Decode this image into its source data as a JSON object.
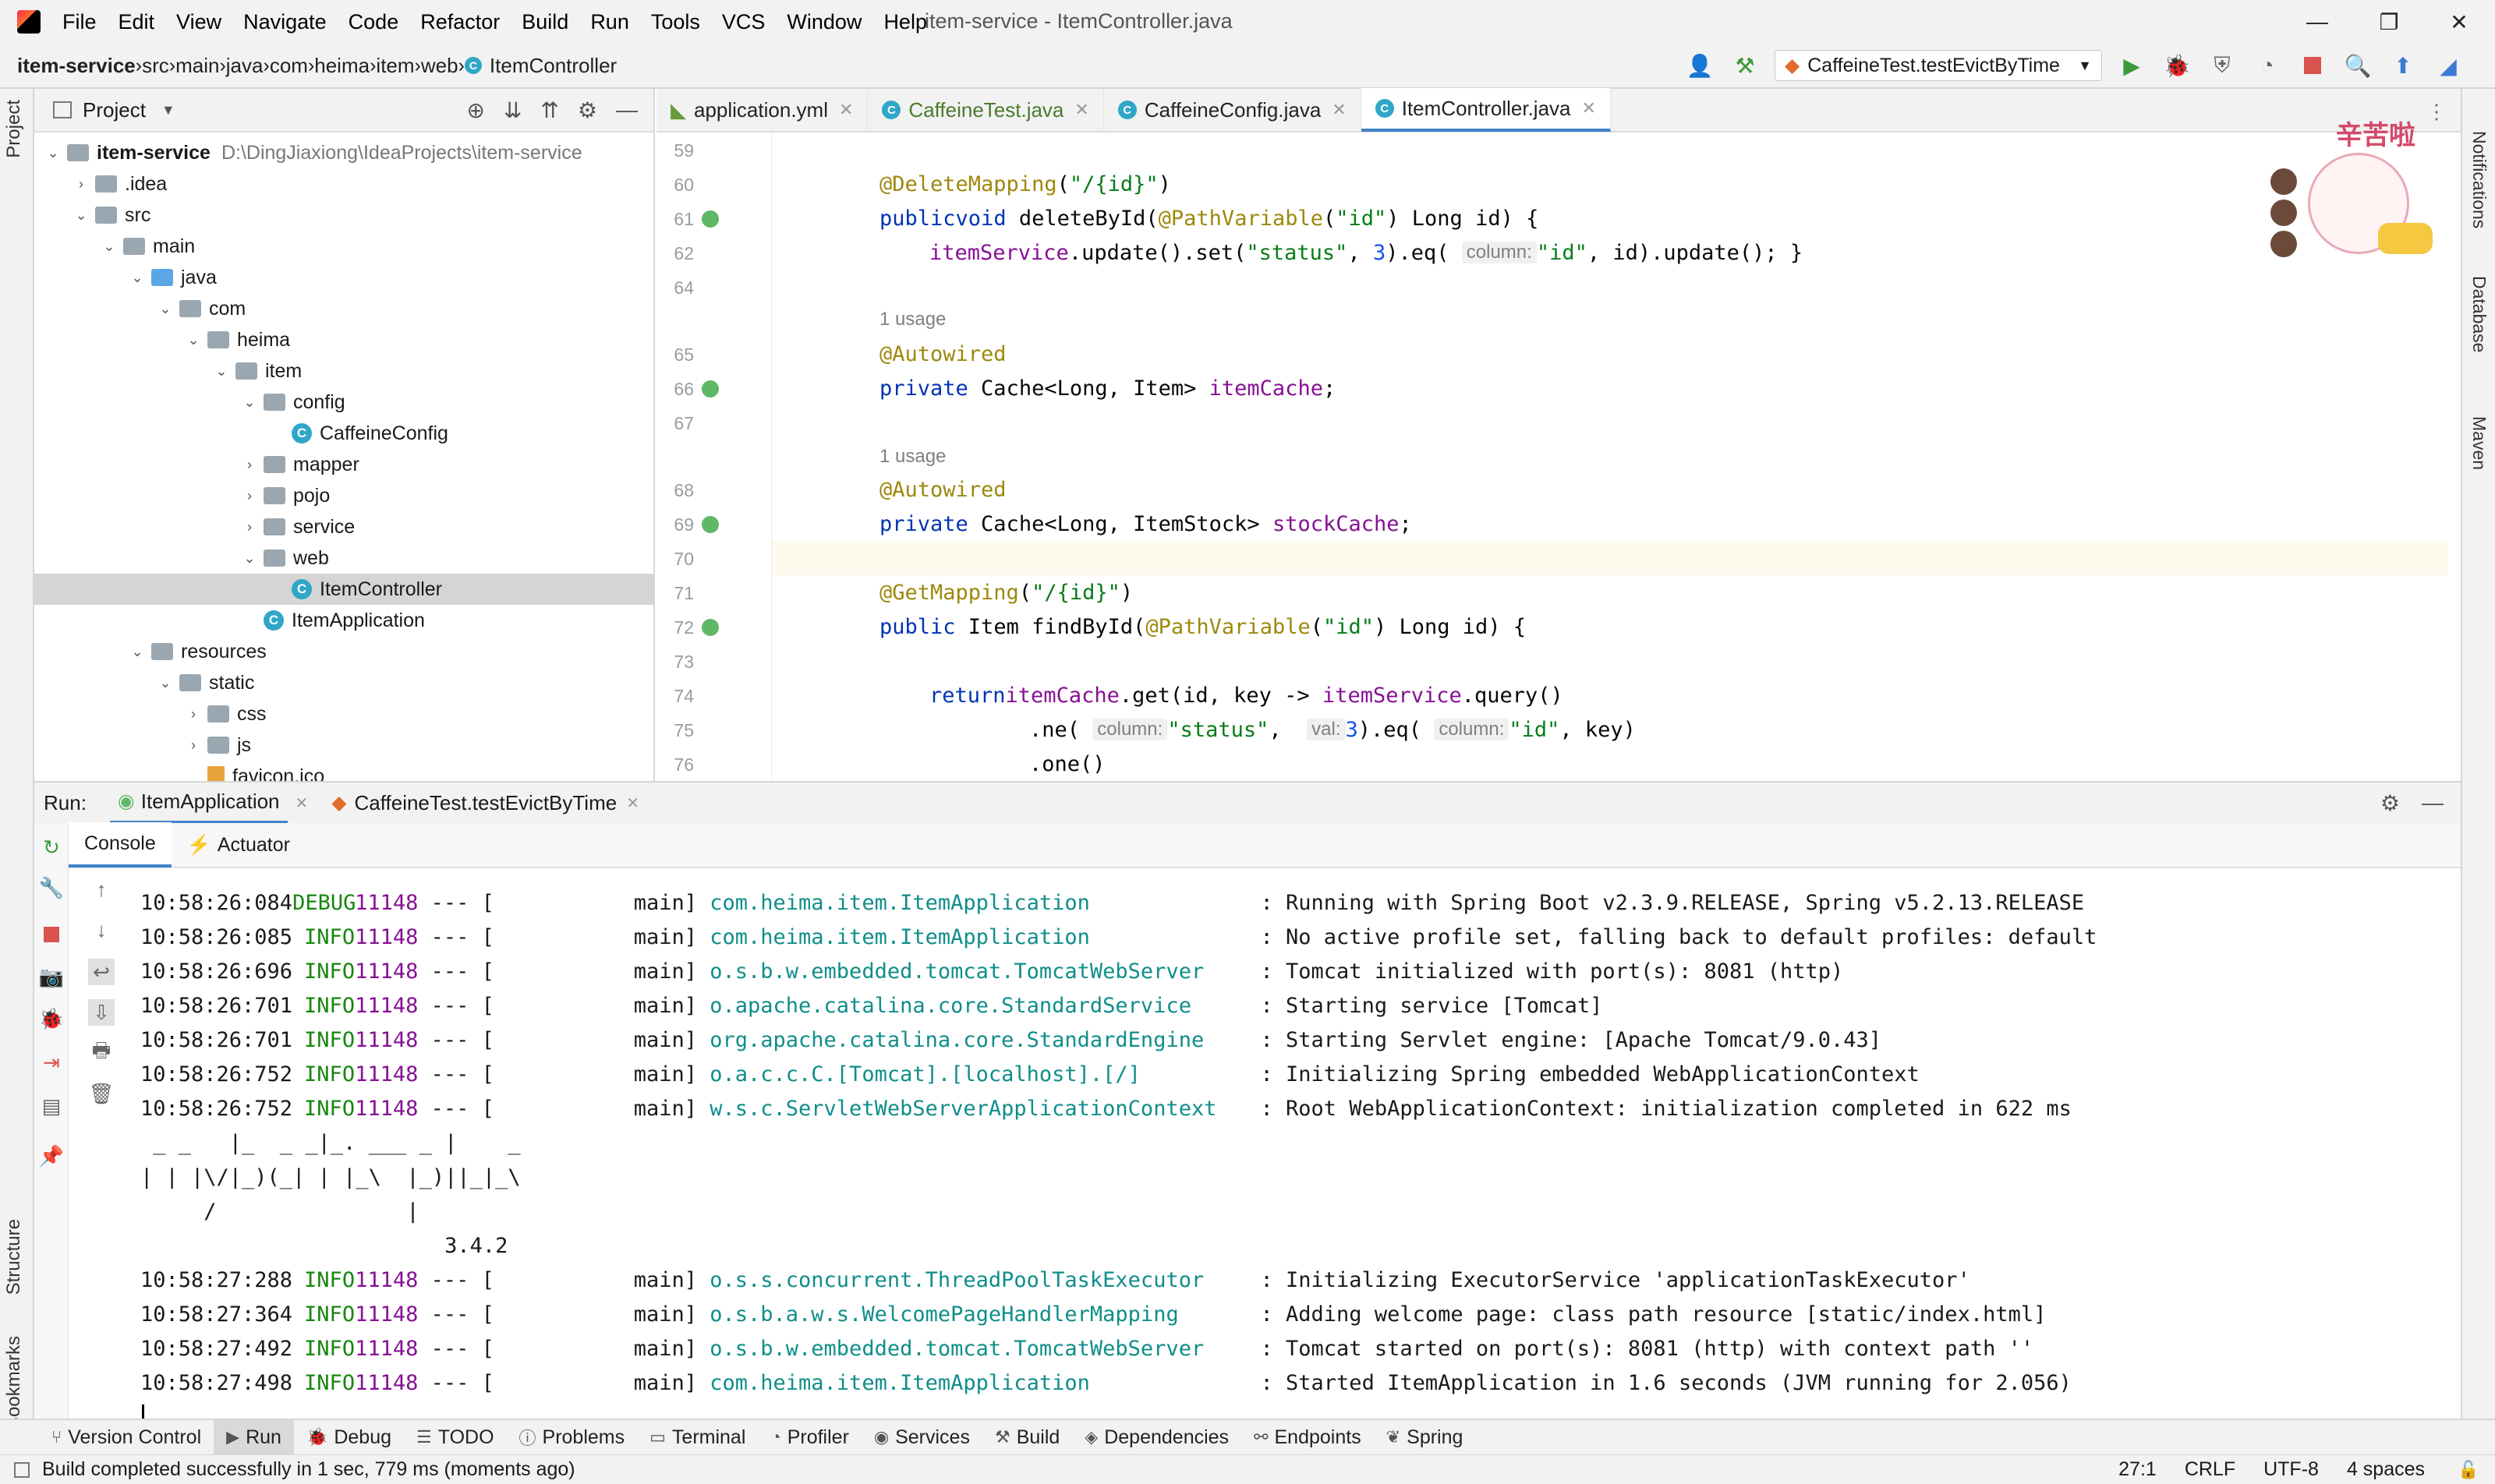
{
  "window": {
    "title": "item-service - ItemController.java",
    "menu": [
      "File",
      "Edit",
      "View",
      "Navigate",
      "Code",
      "Refactor",
      "Build",
      "Run",
      "Tools",
      "VCS",
      "Window",
      "Help"
    ]
  },
  "navbar": {
    "breadcrumbs": [
      "item-service",
      "src",
      "main",
      "java",
      "com",
      "heima",
      "item",
      "web",
      "ItemController"
    ],
    "run_config": "CaffeineTest.testEvictByTime"
  },
  "project": {
    "title": "Project",
    "root_path": "D:\\DingJiaxiong\\IdeaProjects\\item-service",
    "tree": [
      {
        "label": "item-service",
        "depth": 0,
        "arrow": "⌄",
        "type": "module"
      },
      {
        "label": ".idea",
        "depth": 1,
        "arrow": "›",
        "type": "folder"
      },
      {
        "label": "src",
        "depth": 1,
        "arrow": "⌄",
        "type": "folder"
      },
      {
        "label": "main",
        "depth": 2,
        "arrow": "⌄",
        "type": "folder"
      },
      {
        "label": "java",
        "depth": 3,
        "arrow": "⌄",
        "type": "folder-blue"
      },
      {
        "label": "com",
        "depth": 4,
        "arrow": "⌄",
        "type": "folder"
      },
      {
        "label": "heima",
        "depth": 5,
        "arrow": "⌄",
        "type": "folder"
      },
      {
        "label": "item",
        "depth": 6,
        "arrow": "⌄",
        "type": "folder"
      },
      {
        "label": "config",
        "depth": 7,
        "arrow": "⌄",
        "type": "folder"
      },
      {
        "label": "CaffeineConfig",
        "depth": 8,
        "arrow": "",
        "type": "class"
      },
      {
        "label": "mapper",
        "depth": 7,
        "arrow": "›",
        "type": "folder"
      },
      {
        "label": "pojo",
        "depth": 7,
        "arrow": "›",
        "type": "folder"
      },
      {
        "label": "service",
        "depth": 7,
        "arrow": "›",
        "type": "folder"
      },
      {
        "label": "web",
        "depth": 7,
        "arrow": "⌄",
        "type": "folder"
      },
      {
        "label": "ItemController",
        "depth": 8,
        "arrow": "",
        "type": "class",
        "selected": true
      },
      {
        "label": "ItemApplication",
        "depth": 7,
        "arrow": "",
        "type": "class"
      },
      {
        "label": "resources",
        "depth": 3,
        "arrow": "⌄",
        "type": "folder"
      },
      {
        "label": "static",
        "depth": 4,
        "arrow": "⌄",
        "type": "folder"
      },
      {
        "label": "css",
        "depth": 5,
        "arrow": "›",
        "type": "folder"
      },
      {
        "label": "js",
        "depth": 5,
        "arrow": "›",
        "type": "folder"
      },
      {
        "label": "favicon.ico",
        "depth": 5,
        "arrow": "",
        "type": "file"
      }
    ]
  },
  "editor": {
    "tabs": [
      {
        "label": "application.yml",
        "active": false
      },
      {
        "label": "CaffeineTest.java",
        "active": false
      },
      {
        "label": "CaffeineConfig.java",
        "active": false
      },
      {
        "label": "ItemController.java",
        "active": true
      }
    ],
    "sticker_text": "辛苦啦",
    "lines": [
      {
        "n": "59",
        "text": ""
      },
      {
        "n": "60",
        "text": "@DeleteMapping(\"/{id}\")"
      },
      {
        "n": "61",
        "text": "public void deleteById(@PathVariable(\"id\") Long id) {"
      },
      {
        "n": "62",
        "text": "itemService.update().set(\"status\", 3).eq( column: \"id\", id).update(); }"
      },
      {
        "n": "64",
        "text": ""
      },
      {
        "n": "",
        "text": "1 usage"
      },
      {
        "n": "65",
        "text": "@Autowired"
      },
      {
        "n": "66",
        "text": "private Cache<Long, Item> itemCache;"
      },
      {
        "n": "67",
        "text": ""
      },
      {
        "n": "",
        "text": "1 usage"
      },
      {
        "n": "68",
        "text": "@Autowired"
      },
      {
        "n": "69",
        "text": "private Cache<Long, ItemStock> stockCache;"
      },
      {
        "n": "70",
        "text": ""
      },
      {
        "n": "71",
        "text": "@GetMapping(\"/{id}\")"
      },
      {
        "n": "72",
        "text": "public Item findById(@PathVariable(\"id\") Long id) {"
      },
      {
        "n": "73",
        "text": ""
      },
      {
        "n": "74",
        "text": "return itemCache.get(id, key -> itemService.query()"
      },
      {
        "n": "75",
        "text": ".ne( column: \"status\",  val: 3).eq( column: \"id\", key)"
      },
      {
        "n": "76",
        "text": ".one()"
      }
    ]
  },
  "run": {
    "label": "Run:",
    "tabs": [
      "ItemApplication",
      "CaffeineTest.testEvictByTime"
    ],
    "subtabs": [
      "Console",
      "Actuator"
    ],
    "log": [
      {
        "time": "10:58:26:084",
        "level": "DEBUG",
        "pid": "11148",
        "thread": "main",
        "logger": "com.heima.item.ItemApplication",
        "msg": "Running with Spring Boot v2.3.9.RELEASE, Spring v5.2.13.RELEASE"
      },
      {
        "time": "10:58:26:085",
        "level": "INFO",
        "pid": "11148",
        "thread": "main",
        "logger": "com.heima.item.ItemApplication",
        "msg": "No active profile set, falling back to default profiles: default"
      },
      {
        "time": "10:58:26:696",
        "level": "INFO",
        "pid": "11148",
        "thread": "main",
        "logger": "o.s.b.w.embedded.tomcat.TomcatWebServer",
        "msg": "Tomcat initialized with port(s): 8081 (http)"
      },
      {
        "time": "10:58:26:701",
        "level": "INFO",
        "pid": "11148",
        "thread": "main",
        "logger": "o.apache.catalina.core.StandardService",
        "msg": "Starting service [Tomcat]"
      },
      {
        "time": "10:58:26:701",
        "level": "INFO",
        "pid": "11148",
        "thread": "main",
        "logger": "org.apache.catalina.core.StandardEngine",
        "msg": "Starting Servlet engine: [Apache Tomcat/9.0.43]"
      },
      {
        "time": "10:58:26:752",
        "level": "INFO",
        "pid": "11148",
        "thread": "main",
        "logger": "o.a.c.c.C.[Tomcat].[localhost].[/]",
        "msg": "Initializing Spring embedded WebApplicationContext"
      },
      {
        "time": "10:58:26:752",
        "level": "INFO",
        "pid": "11148",
        "thread": "main",
        "logger": "w.s.c.ServletWebServerApplicationContext",
        "msg": "Root WebApplicationContext: initialization completed in 622 ms"
      }
    ],
    "banner": [
      " _ _   |_  _ _|_. ___ _ |    _",
      "| | |\\/|_)(_| | |_\\  |_)||_|_\\",
      "     /               |",
      "                        3.4.2"
    ],
    "log2": [
      {
        "time": "10:58:27:288",
        "level": "INFO",
        "pid": "11148",
        "thread": "main",
        "logger": "o.s.s.concurrent.ThreadPoolTaskExecutor",
        "msg": "Initializing ExecutorService 'applicationTaskExecutor'"
      },
      {
        "time": "10:58:27:364",
        "level": "INFO",
        "pid": "11148",
        "thread": "main",
        "logger": "o.s.b.a.w.s.WelcomePageHandlerMapping",
        "msg": "Adding welcome page: class path resource [static/index.html]"
      },
      {
        "time": "10:58:27:492",
        "level": "INFO",
        "pid": "11148",
        "thread": "main",
        "logger": "o.s.b.w.embedded.tomcat.TomcatWebServer",
        "msg": "Tomcat started on port(s): 8081 (http) with context path ''"
      },
      {
        "time": "10:58:27:498",
        "level": "INFO",
        "pid": "11148",
        "thread": "main",
        "logger": "com.heima.item.ItemApplication",
        "msg": "Started ItemApplication in 1.6 seconds (JVM running for 2.056)"
      }
    ]
  },
  "bottom_tabs": [
    {
      "label": "Version Control",
      "icon": "git-icon"
    },
    {
      "label": "Run",
      "icon": "run-icon",
      "active": true
    },
    {
      "label": "Debug",
      "icon": "bug-icon"
    },
    {
      "label": "TODO",
      "icon": "list-icon"
    },
    {
      "label": "Problems",
      "icon": "info-icon"
    },
    {
      "label": "Terminal",
      "icon": "terminal-icon"
    },
    {
      "label": "Profiler",
      "icon": "profiler-icon"
    },
    {
      "label": "Services",
      "icon": "services-icon"
    },
    {
      "label": "Build",
      "icon": "hammer-icon"
    },
    {
      "label": "Dependencies",
      "icon": "layers-icon"
    },
    {
      "label": "Endpoints",
      "icon": "endpoints-icon"
    },
    {
      "label": "Spring",
      "icon": "spring-icon"
    }
  ],
  "side_labels": {
    "left": [
      "Project",
      "Structure",
      "Bookmarks"
    ],
    "right": [
      "Notifications",
      "Database",
      "Maven"
    ]
  },
  "status": {
    "message": "Build completed successfully in 1 sec, 779 ms (moments ago)",
    "position": "27:1",
    "line_sep": "CRLF",
    "encoding": "UTF-8",
    "indent": "4 spaces"
  }
}
